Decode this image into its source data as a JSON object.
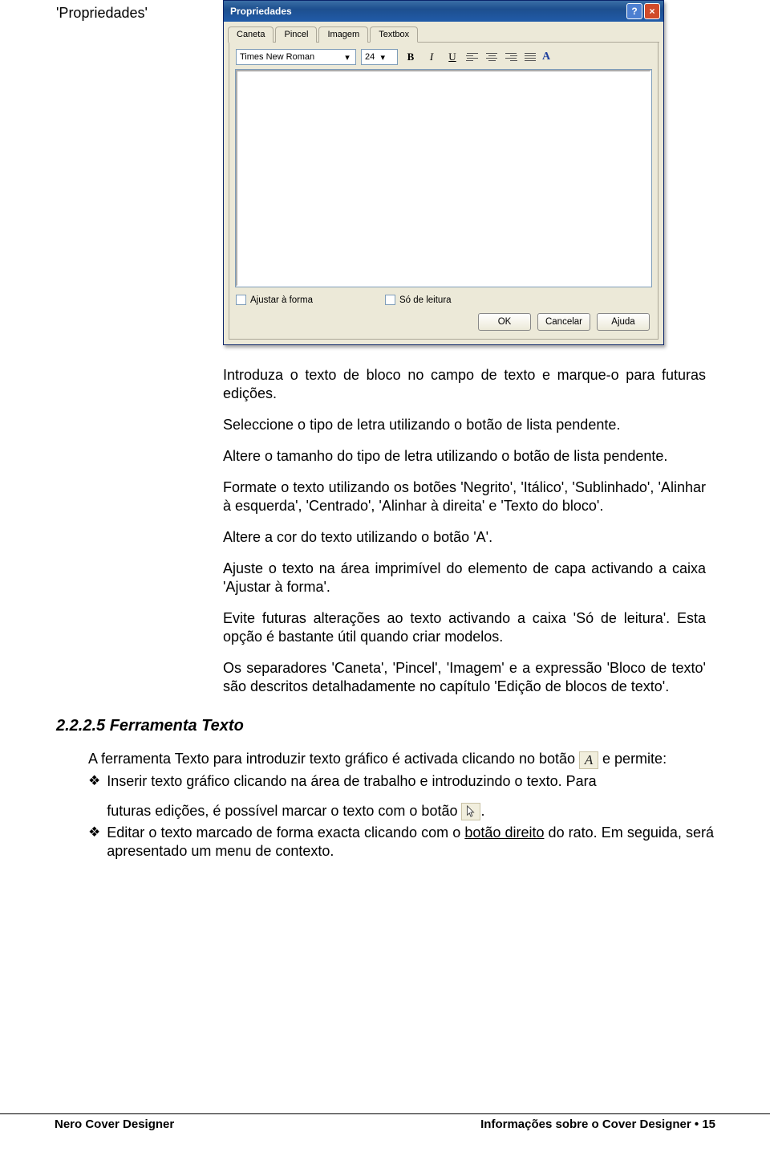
{
  "label_prop": "'Propriedades'",
  "dialog": {
    "title": "Propriedades",
    "tabs": [
      "Caneta",
      "Pincel",
      "Imagem",
      "Textbox"
    ],
    "active_tab": 3,
    "font_name": "Times New Roman",
    "font_size": "24",
    "checkbox_fit": "Ajustar à forma",
    "checkbox_ro": "Só de leitura",
    "btn_ok": "OK",
    "btn_cancel": "Cancelar",
    "btn_help": "Ajuda"
  },
  "paras": {
    "p1": "Introduza o texto de bloco no campo de texto e marque-o para futuras edições.",
    "p2": "Seleccione o tipo de letra utilizando o botão de lista pendente.",
    "p3": "Altere o tamanho do tipo de letra utilizando o botão de lista pendente.",
    "p4": "Formate o texto utilizando os botões 'Negrito', 'Itálico', 'Sublinhado', 'Alinhar à esquerda', 'Centrado', 'Alinhar à direita' e 'Texto do bloco'.",
    "p5": "Altere a cor do texto utilizando o botão 'A'.",
    "p6": "Ajuste o texto na área imprimível do elemento de capa activando a caixa 'Ajustar à forma'.",
    "p7": "Evite futuras alterações ao texto activando a caixa 'Só de leitura'. Esta opção é bastante útil quando criar modelos.",
    "p8": "Os separadores 'Caneta', 'Pincel', 'Imagem' e a expressão 'Bloco de texto' são descritos detalhadamente no capítulo 'Edição de blocos de texto'."
  },
  "section_heading": "2.2.2.5  Ferramenta Texto",
  "lower": {
    "intro_a": "A ferramenta Texto para introduzir texto gráfico é activada clicando no botão ",
    "intro_b": " e permite:",
    "b1a": "Inserir texto gráfico clicando na área de trabalho e introduzindo o texto. Para ",
    "b1b": "futuras edições, é possível marcar o texto com o botão ",
    "b1c": ".",
    "b2a": "Editar o texto marcado de forma exacta clicando com o ",
    "b2u": "botão direito",
    "b2b": " do rato. Em seguida, será apresentado um menu de contexto."
  },
  "footer": {
    "left": "Nero Cover Designer",
    "right_a": "Informações sobre o Cover Designer",
    "right_page": "15"
  }
}
